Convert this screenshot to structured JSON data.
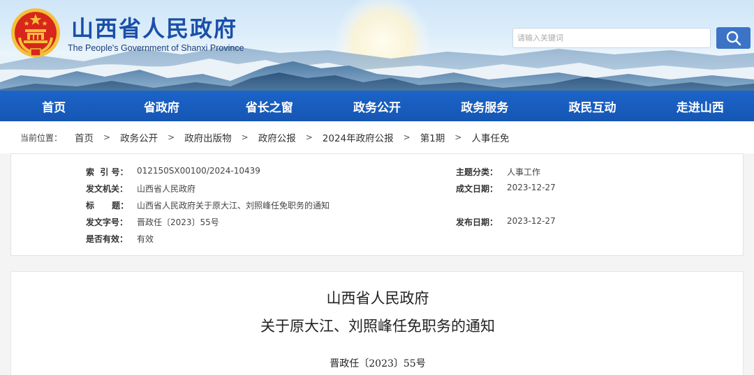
{
  "header": {
    "title": "山西省人民政府",
    "subtitle": "The People's Government of Shanxi Province",
    "search_placeholder": "请输入关键词"
  },
  "nav": {
    "items": [
      "首页",
      "省政府",
      "省长之窗",
      "政务公开",
      "政务服务",
      "政民互动",
      "走进山西"
    ]
  },
  "breadcrumb": {
    "lead": "当前位置：",
    "items": [
      "首页",
      "政务公开",
      "政府出版物",
      "政府公报",
      "2024年政府公报",
      "第1期",
      "人事任免"
    ],
    "separator": ">"
  },
  "meta": {
    "index_label": "索  引 号：",
    "index_value": "012150SX00100/2024-10439",
    "category_label": "主题分类：",
    "category_value": "人事工作",
    "issuer_label": "发文机关：",
    "issuer_value": "山西省人民政府",
    "created_label": "成文日期：",
    "created_value": "2023-12-27",
    "title_label": "标      题：",
    "title_value": "山西省人民政府关于原大江、刘照峰任免职务的通知",
    "docno_label": "发文字号：",
    "docno_value": "晋政任〔2023〕55号",
    "published_label": "发布日期：",
    "published_value": "2023-12-27",
    "valid_label": "是否有效：",
    "valid_value": "有效"
  },
  "document": {
    "title_line1": "山西省人民政府",
    "title_line2": "关于原大江、刘照峰任免职务的通知",
    "doc_number": "晋政任〔2023〕55号"
  },
  "colors": {
    "brand_blue": "#1a4fa8",
    "nav_blue": "#1b64c8",
    "search_button": "#3b73c6",
    "emblem_red": "#d8261c",
    "emblem_gold": "#f3c13a"
  },
  "icons": {
    "emblem": "national-emblem-icon",
    "search": "magnifier-icon"
  }
}
